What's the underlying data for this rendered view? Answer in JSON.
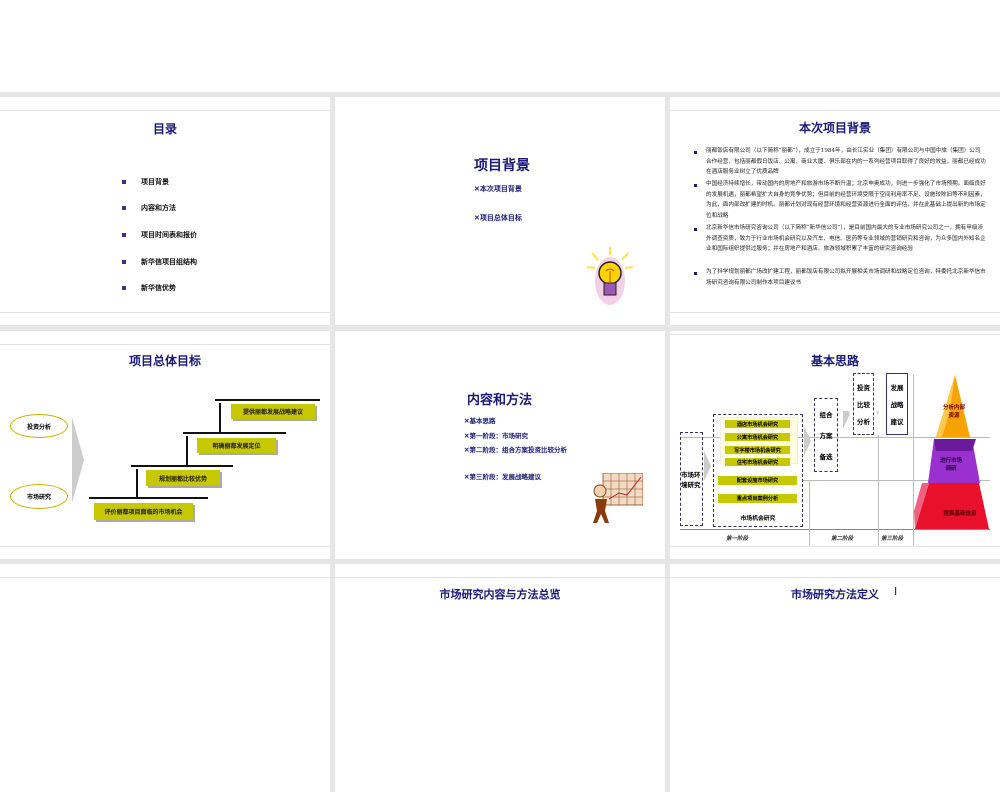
{
  "slides": {
    "toc": {
      "title": "目录",
      "items": [
        "项目背景",
        "内容和方法",
        "项目时间表和报价",
        "新华信项目组结构",
        "新华信优势"
      ]
    },
    "section1": {
      "title": "项目背景",
      "items": [
        "本次项目背景",
        "项目总体目标"
      ]
    },
    "background": {
      "title": "本次项目背景",
      "paragraphs": [
        "丽都饭店有限公司（以下简称“丽都”），成立于1984年，由长江实业（集团）有限公司与中国中旅（集团）公司合作经营，包括丽都假日饭店、公寓、商业大厦、俱乐部在内的一系列经营项目取得了良好的效益，丽都已经成功在酒店服务业树立了优质品牌",
        "中国经济持续增长，带动国内的房地产和旅游市场不断升温；北京申奥成功，则进一步强化了市场预期。面临良好的发展机遇，丽都希望扩大自身的竞争优势；但目前的经营环境受限于空间利用率不足、设施较陈旧等不利因素，为此，面内部改扩建的时机。丽都计划对现有经营环境和经营资源进行全面的评估，并在此基础上提出新的市场定位和战略",
        "北京新华信市场研究咨询公司（以下简称“新华信公司”），是目前国内最大的专业市场研究公司之一，拥有甲级涉外调查资质，致力于行业市场机会研究以及汽车、电信、医药等专业领域的营销研究和咨询，为众多国内外知名企业和国际组织提供过服务；并在房地产和酒店、旅游领域积累了丰富的研究咨询经验",
        "为了科学规划丽都广场改扩建工程，丽都饭店有限公司拟开展相关市场调研和战略定位咨询，特委托北京新华信市场研究咨询有限公司制作本项目建议书"
      ]
    },
    "goals": {
      "title": "项目总体目标",
      "left": [
        "投资分析",
        "市场研究"
      ],
      "steps": [
        "评价丽都项目面临的市场机会",
        "规划丽都比较优势",
        "明确丽都发展定位",
        "提供丽都发展战略建议"
      ]
    },
    "section2": {
      "title": "内容和方法",
      "items": [
        "基本思路",
        "第一阶段：市场研究",
        "第二阶段：组合方案投资比较分析",
        "第三阶段：发展战略建议"
      ]
    },
    "approach": {
      "title": "基本思路",
      "env": "市场环境研究",
      "inner": [
        "酒店市场机会研究",
        "公寓市场机会研究",
        "写字楼市场机会研究",
        "住宅市场机会研究"
      ],
      "supp": [
        "配套设施市场研究",
        "重点项目案例分析"
      ],
      "group_label": "市场机会研究",
      "combo": [
        "组合",
        "方案",
        "备选"
      ],
      "invest": [
        "投资",
        "比较",
        "分析"
      ],
      "strategy": [
        "发展",
        "战略",
        "建议"
      ],
      "pyramid": [
        "分析内部资源",
        "进行市场调研",
        "搜集基础信息"
      ],
      "stages": [
        "第一阶段",
        "第二阶段",
        "第三阶段"
      ]
    },
    "row3": {
      "b": "市场研究内容与方法总览",
      "c": "市场研究方法定义",
      "cursor": "I"
    }
  },
  "colors": {
    "navy": "#1a1a7a",
    "olive": "#c8c800",
    "orange": "#f5a300",
    "purple": "#9933cc",
    "red": "#e8102a"
  },
  "bullet_glyph": "⟨"
}
